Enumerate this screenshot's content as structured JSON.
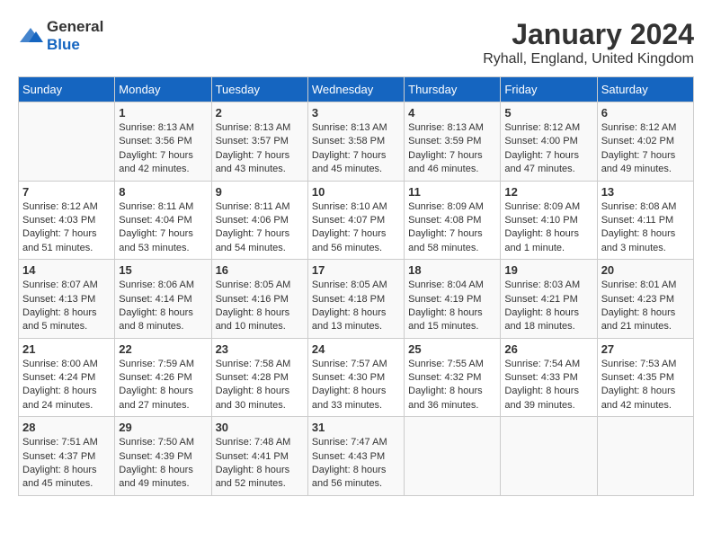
{
  "header": {
    "logo": {
      "general": "General",
      "blue": "Blue"
    },
    "title": "January 2024",
    "subtitle": "Ryhall, England, United Kingdom"
  },
  "calendar": {
    "days_of_week": [
      "Sunday",
      "Monday",
      "Tuesday",
      "Wednesday",
      "Thursday",
      "Friday",
      "Saturday"
    ],
    "weeks": [
      [
        {
          "day": "",
          "sunrise": "",
          "sunset": "",
          "daylight": "",
          "empty": true
        },
        {
          "day": "1",
          "sunrise": "Sunrise: 8:13 AM",
          "sunset": "Sunset: 3:56 PM",
          "daylight": "Daylight: 7 hours and 42 minutes."
        },
        {
          "day": "2",
          "sunrise": "Sunrise: 8:13 AM",
          "sunset": "Sunset: 3:57 PM",
          "daylight": "Daylight: 7 hours and 43 minutes."
        },
        {
          "day": "3",
          "sunrise": "Sunrise: 8:13 AM",
          "sunset": "Sunset: 3:58 PM",
          "daylight": "Daylight: 7 hours and 45 minutes."
        },
        {
          "day": "4",
          "sunrise": "Sunrise: 8:13 AM",
          "sunset": "Sunset: 3:59 PM",
          "daylight": "Daylight: 7 hours and 46 minutes."
        },
        {
          "day": "5",
          "sunrise": "Sunrise: 8:12 AM",
          "sunset": "Sunset: 4:00 PM",
          "daylight": "Daylight: 7 hours and 47 minutes."
        },
        {
          "day": "6",
          "sunrise": "Sunrise: 8:12 AM",
          "sunset": "Sunset: 4:02 PM",
          "daylight": "Daylight: 7 hours and 49 minutes."
        }
      ],
      [
        {
          "day": "7",
          "sunrise": "Sunrise: 8:12 AM",
          "sunset": "Sunset: 4:03 PM",
          "daylight": "Daylight: 7 hours and 51 minutes."
        },
        {
          "day": "8",
          "sunrise": "Sunrise: 8:11 AM",
          "sunset": "Sunset: 4:04 PM",
          "daylight": "Daylight: 7 hours and 53 minutes."
        },
        {
          "day": "9",
          "sunrise": "Sunrise: 8:11 AM",
          "sunset": "Sunset: 4:06 PM",
          "daylight": "Daylight: 7 hours and 54 minutes."
        },
        {
          "day": "10",
          "sunrise": "Sunrise: 8:10 AM",
          "sunset": "Sunset: 4:07 PM",
          "daylight": "Daylight: 7 hours and 56 minutes."
        },
        {
          "day": "11",
          "sunrise": "Sunrise: 8:09 AM",
          "sunset": "Sunset: 4:08 PM",
          "daylight": "Daylight: 7 hours and 58 minutes."
        },
        {
          "day": "12",
          "sunrise": "Sunrise: 8:09 AM",
          "sunset": "Sunset: 4:10 PM",
          "daylight": "Daylight: 8 hours and 1 minute."
        },
        {
          "day": "13",
          "sunrise": "Sunrise: 8:08 AM",
          "sunset": "Sunset: 4:11 PM",
          "daylight": "Daylight: 8 hours and 3 minutes."
        }
      ],
      [
        {
          "day": "14",
          "sunrise": "Sunrise: 8:07 AM",
          "sunset": "Sunset: 4:13 PM",
          "daylight": "Daylight: 8 hours and 5 minutes."
        },
        {
          "day": "15",
          "sunrise": "Sunrise: 8:06 AM",
          "sunset": "Sunset: 4:14 PM",
          "daylight": "Daylight: 8 hours and 8 minutes."
        },
        {
          "day": "16",
          "sunrise": "Sunrise: 8:05 AM",
          "sunset": "Sunset: 4:16 PM",
          "daylight": "Daylight: 8 hours and 10 minutes."
        },
        {
          "day": "17",
          "sunrise": "Sunrise: 8:05 AM",
          "sunset": "Sunset: 4:18 PM",
          "daylight": "Daylight: 8 hours and 13 minutes."
        },
        {
          "day": "18",
          "sunrise": "Sunrise: 8:04 AM",
          "sunset": "Sunset: 4:19 PM",
          "daylight": "Daylight: 8 hours and 15 minutes."
        },
        {
          "day": "19",
          "sunrise": "Sunrise: 8:03 AM",
          "sunset": "Sunset: 4:21 PM",
          "daylight": "Daylight: 8 hours and 18 minutes."
        },
        {
          "day": "20",
          "sunrise": "Sunrise: 8:01 AM",
          "sunset": "Sunset: 4:23 PM",
          "daylight": "Daylight: 8 hours and 21 minutes."
        }
      ],
      [
        {
          "day": "21",
          "sunrise": "Sunrise: 8:00 AM",
          "sunset": "Sunset: 4:24 PM",
          "daylight": "Daylight: 8 hours and 24 minutes."
        },
        {
          "day": "22",
          "sunrise": "Sunrise: 7:59 AM",
          "sunset": "Sunset: 4:26 PM",
          "daylight": "Daylight: 8 hours and 27 minutes."
        },
        {
          "day": "23",
          "sunrise": "Sunrise: 7:58 AM",
          "sunset": "Sunset: 4:28 PM",
          "daylight": "Daylight: 8 hours and 30 minutes."
        },
        {
          "day": "24",
          "sunrise": "Sunrise: 7:57 AM",
          "sunset": "Sunset: 4:30 PM",
          "daylight": "Daylight: 8 hours and 33 minutes."
        },
        {
          "day": "25",
          "sunrise": "Sunrise: 7:55 AM",
          "sunset": "Sunset: 4:32 PM",
          "daylight": "Daylight: 8 hours and 36 minutes."
        },
        {
          "day": "26",
          "sunrise": "Sunrise: 7:54 AM",
          "sunset": "Sunset: 4:33 PM",
          "daylight": "Daylight: 8 hours and 39 minutes."
        },
        {
          "day": "27",
          "sunrise": "Sunrise: 7:53 AM",
          "sunset": "Sunset: 4:35 PM",
          "daylight": "Daylight: 8 hours and 42 minutes."
        }
      ],
      [
        {
          "day": "28",
          "sunrise": "Sunrise: 7:51 AM",
          "sunset": "Sunset: 4:37 PM",
          "daylight": "Daylight: 8 hours and 45 minutes."
        },
        {
          "day": "29",
          "sunrise": "Sunrise: 7:50 AM",
          "sunset": "Sunset: 4:39 PM",
          "daylight": "Daylight: 8 hours and 49 minutes."
        },
        {
          "day": "30",
          "sunrise": "Sunrise: 7:48 AM",
          "sunset": "Sunset: 4:41 PM",
          "daylight": "Daylight: 8 hours and 52 minutes."
        },
        {
          "day": "31",
          "sunrise": "Sunrise: 7:47 AM",
          "sunset": "Sunset: 4:43 PM",
          "daylight": "Daylight: 8 hours and 56 minutes."
        },
        {
          "day": "",
          "sunrise": "",
          "sunset": "",
          "daylight": "",
          "empty": true
        },
        {
          "day": "",
          "sunrise": "",
          "sunset": "",
          "daylight": "",
          "empty": true
        },
        {
          "day": "",
          "sunrise": "",
          "sunset": "",
          "daylight": "",
          "empty": true
        }
      ]
    ]
  }
}
